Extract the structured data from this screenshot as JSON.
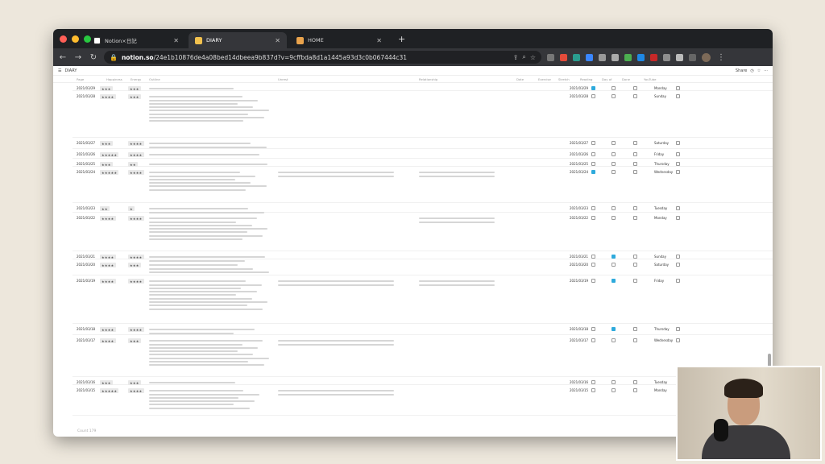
{
  "browser": {
    "tabs": [
      {
        "label": "Notion×日記",
        "active": false
      },
      {
        "label": "DIARY",
        "active": true
      },
      {
        "label": "HOME",
        "active": false
      }
    ],
    "url_domain": "notion.so",
    "url_path": "/24e1b10876de4a08bed14dbeea9b837d?v=9cffbda8d1a1445a93d3c0b067444c31"
  },
  "notion": {
    "breadcrumb": "DIARY",
    "share_label": "Share"
  },
  "columns": [
    "Page",
    "Happiness",
    "Energy",
    "Outline",
    "Unrest",
    "Relationship",
    "Date",
    "Exercise",
    "Stretch",
    "Reading",
    "Day of",
    "Done",
    "YouTube"
  ],
  "rows": [
    {
      "date": "2021/03/29",
      "stars": "★★★",
      "stars2": "★★★",
      "checks": [
        true,
        false,
        false,
        false
      ],
      "day": "Monday"
    },
    {
      "date": "2021/03/28",
      "stars": "★★★★",
      "stars2": "★★★",
      "checks": [
        false,
        false,
        false,
        false
      ],
      "day": "Sunday"
    },
    {
      "date": "2021/03/27",
      "stars": "★★★",
      "stars2": "★★★★",
      "checks": [
        false,
        false,
        false,
        false
      ],
      "day": "Saturday"
    },
    {
      "date": "2021/03/26",
      "stars": "★★★★★",
      "stars2": "★★★★",
      "checks": [
        false,
        false,
        false,
        false
      ],
      "day": "Friday"
    },
    {
      "date": "2021/03/25",
      "stars": "★★★",
      "stars2": "★★",
      "checks": [
        false,
        false,
        false,
        false
      ],
      "day": "Thursday"
    },
    {
      "date": "2021/03/24",
      "stars": "★★★★★",
      "stars2": "★★★★",
      "checks": [
        true,
        false,
        false,
        false
      ],
      "day": "Wednesday"
    },
    {
      "date": "2021/03/23",
      "stars": "★★",
      "stars2": "★",
      "checks": [
        false,
        false,
        false,
        false
      ],
      "day": "Tuesday"
    },
    {
      "date": "2021/03/22",
      "stars": "★★★★",
      "stars2": "★★★★",
      "checks": [
        false,
        false,
        false,
        false
      ],
      "day": "Monday"
    },
    {
      "date": "2021/03/21",
      "stars": "★★★★",
      "stars2": "★★★★",
      "checks": [
        false,
        true,
        false,
        false
      ],
      "day": "Sunday"
    },
    {
      "date": "2021/03/20",
      "stars": "★★★★",
      "stars2": "★★★",
      "checks": [
        false,
        false,
        false,
        false
      ],
      "day": "Saturday"
    },
    {
      "date": "2021/03/19",
      "stars": "★★★★",
      "stars2": "★★★★",
      "checks": [
        false,
        true,
        false,
        false
      ],
      "day": "Friday"
    },
    {
      "date": "2021/03/18",
      "stars": "★★★★",
      "stars2": "★★★★",
      "checks": [
        false,
        true,
        false,
        false
      ],
      "day": "Thursday"
    },
    {
      "date": "2021/03/17",
      "stars": "★★★★",
      "stars2": "★★★",
      "checks": [
        false,
        false,
        false,
        false
      ],
      "day": "Wednesday"
    },
    {
      "date": "2021/03/16",
      "stars": "★★★",
      "stars2": "★★★",
      "checks": [
        false,
        false,
        false,
        false
      ],
      "day": "Tuesday"
    },
    {
      "date": "2021/03/15",
      "stars": "★★★★★",
      "stars2": "★★★★",
      "checks": [
        false,
        false,
        false,
        false
      ],
      "day": "Monday"
    }
  ],
  "footer_count": "Count 179"
}
